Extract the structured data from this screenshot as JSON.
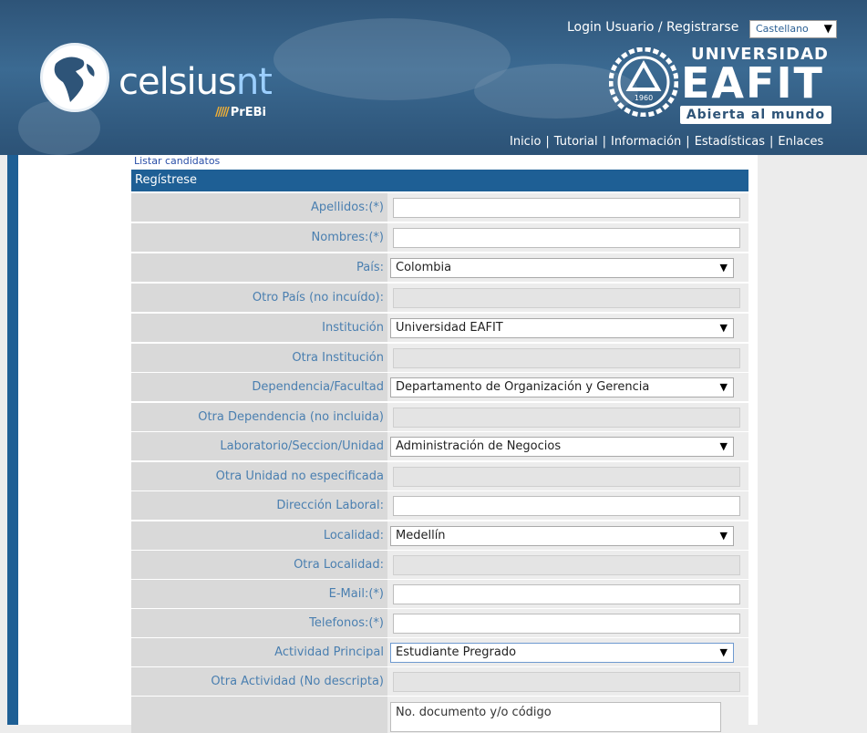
{
  "header": {
    "brand_main": "celsius",
    "brand_accent": "nt",
    "brand_sub": "PrEBi",
    "login_link": "Login Usuario / Registrarse",
    "language": "Castellano",
    "univ_top": "UNIVERSIDAD",
    "univ_name": "EAFIT",
    "univ_slogan": "Abierta al mundo",
    "emblem_year": "1960",
    "nav": [
      "Inicio",
      "Tutorial",
      "Información",
      "Estadísticas",
      "Enlaces"
    ],
    "nav_separator": "|"
  },
  "content": {
    "list_link": "Listar candidatos",
    "form_title": "Regístrese",
    "fields": [
      {
        "label": "Apellidos:(*)",
        "value": ""
      },
      {
        "label": "Nombres:(*)",
        "value": ""
      },
      {
        "label": "País:",
        "value": "Colombia"
      },
      {
        "label": "Otro País (no incuído):",
        "value": ""
      },
      {
        "label": "Institución",
        "value": "Universidad EAFIT"
      },
      {
        "label": "Otra Institución",
        "value": ""
      },
      {
        "label": "Dependencia/Facultad",
        "value": "Departamento de Organización y Gerencia"
      },
      {
        "label": "Otra Dependencia (no incluida)",
        "value": ""
      },
      {
        "label": "Laboratorio/Seccion/Unidad",
        "value": "Administración de Negocios"
      },
      {
        "label": "Otra Unidad no especificada",
        "value": ""
      },
      {
        "label": "Dirección Laboral:",
        "value": ""
      },
      {
        "label": "Localidad:",
        "value": "Medellín"
      },
      {
        "label": "Otra Localidad:",
        "value": ""
      },
      {
        "label": "E-Mail:(*)",
        "value": ""
      },
      {
        "label": "Telefonos:(*)",
        "value": ""
      },
      {
        "label": "Actividad Principal",
        "value": "Estudiante Pregrado"
      },
      {
        "label": "Otra Actividad (No descripta)",
        "value": ""
      },
      {
        "label": "",
        "value": "No. documento y/o código"
      }
    ]
  },
  "colors": {
    "header_blue": "#2e5478",
    "bar_blue": "#1e5f95",
    "label_text": "#4a7fb0",
    "label_bg": "#d9d9d9"
  },
  "icons": [
    "globe-icon",
    "prebi-bars-icon",
    "eafit-emblem-icon",
    "dropdown-arrow-icon"
  ]
}
